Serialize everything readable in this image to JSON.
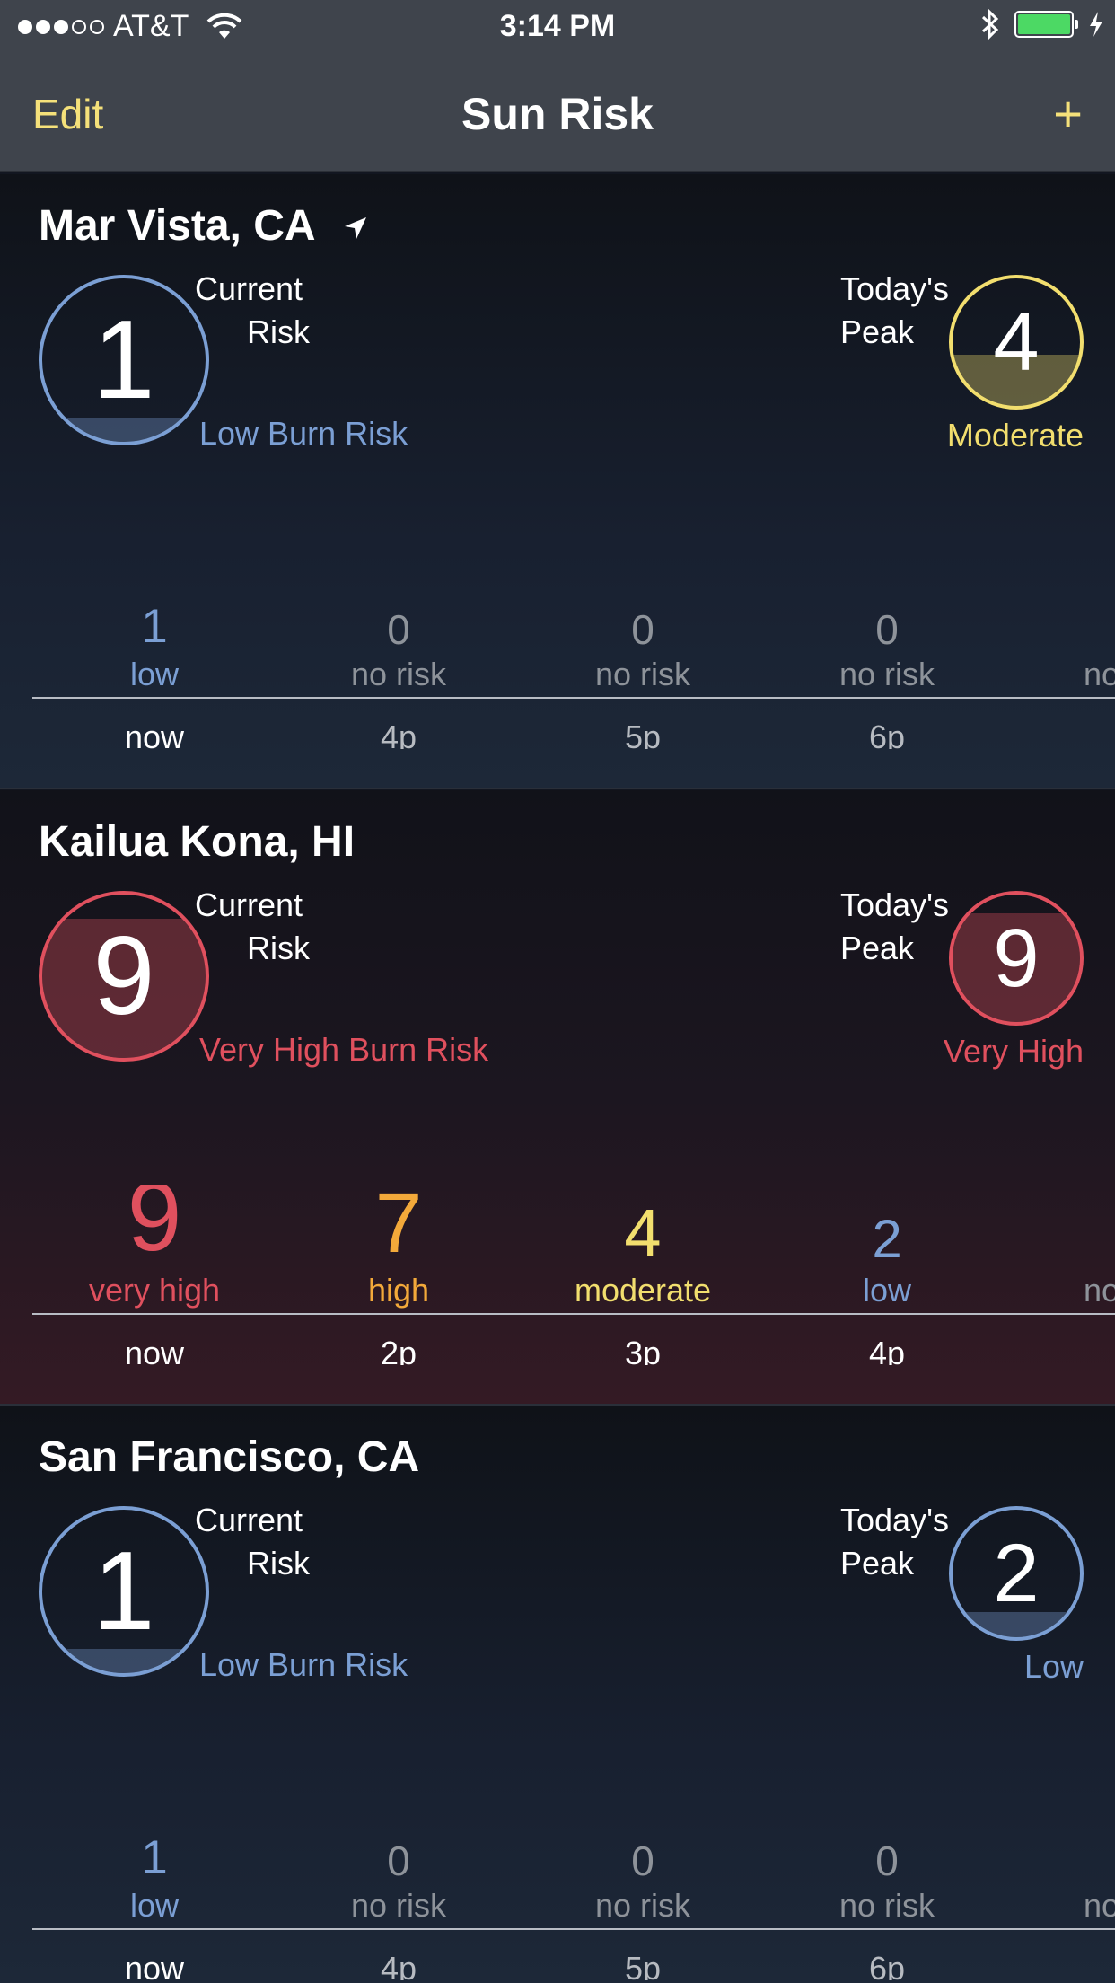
{
  "status_bar": {
    "carrier": "AT&T",
    "time": "3:14 PM",
    "battery_color": "#4cd964"
  },
  "nav": {
    "edit_label": "Edit",
    "title": "Sun Risk",
    "add_label": "+"
  },
  "labels": {
    "current_1": "Current",
    "current_2": "Risk",
    "peak_1": "Today's",
    "peak_2": "Peak"
  },
  "locations": [
    {
      "name": "Mar Vista, CA",
      "has_location_arrow": true,
      "current": {
        "value": "1",
        "description": "Low Burn Risk",
        "color": "#7b9fd4",
        "fill_fraction": 0.15
      },
      "peak": {
        "value": "4",
        "description": "Moderate",
        "color": "#f2de6e",
        "fill_fraction": 0.4
      },
      "hourly": [
        {
          "value": "1",
          "desc": "low",
          "time": "now",
          "color": "#7b9fd4"
        },
        {
          "value": "0",
          "desc": "no risk",
          "time": "4p",
          "color": "#8e939a"
        },
        {
          "value": "0",
          "desc": "no risk",
          "time": "5p",
          "color": "#8e939a"
        },
        {
          "value": "0",
          "desc": "no risk",
          "time": "6p",
          "color": "#8e939a"
        },
        {
          "value": "",
          "desc": "no risk",
          "time": "",
          "color": "#8e939a"
        }
      ]
    },
    {
      "name": "Kailua Kona, HI",
      "has_location_arrow": false,
      "current": {
        "value": "9",
        "description": "Very High Burn Risk",
        "color": "#e0505e",
        "fill_fraction": 0.85
      },
      "peak": {
        "value": "9",
        "description": "Very High",
        "color": "#e0505e",
        "fill_fraction": 0.85
      },
      "hourly": [
        {
          "value": "9",
          "desc": "very high",
          "time": "now",
          "color": "#e0505e"
        },
        {
          "value": "7",
          "desc": "high",
          "time": "2p",
          "color": "#f3a93a"
        },
        {
          "value": "4",
          "desc": "moderate",
          "time": "3p",
          "color": "#f2de6e"
        },
        {
          "value": "2",
          "desc": "low",
          "time": "4p",
          "color": "#7b9fd4"
        },
        {
          "value": "",
          "desc": "no risk",
          "time": "",
          "color": "#8e939a"
        }
      ]
    },
    {
      "name": "San Francisco, CA",
      "has_location_arrow": false,
      "current": {
        "value": "1",
        "description": "Low Burn Risk",
        "color": "#7b9fd4",
        "fill_fraction": 0.15
      },
      "peak": {
        "value": "2",
        "description": "Low",
        "color": "#7b9fd4",
        "fill_fraction": 0.2
      },
      "hourly": [
        {
          "value": "1",
          "desc": "low",
          "time": "now",
          "color": "#7b9fd4"
        },
        {
          "value": "0",
          "desc": "no risk",
          "time": "4p",
          "color": "#8e939a"
        },
        {
          "value": "0",
          "desc": "no risk",
          "time": "5p",
          "color": "#8e939a"
        },
        {
          "value": "0",
          "desc": "no risk",
          "time": "6p",
          "color": "#8e939a"
        },
        {
          "value": "",
          "desc": "no risk",
          "time": "",
          "color": "#8e939a"
        }
      ]
    }
  ]
}
